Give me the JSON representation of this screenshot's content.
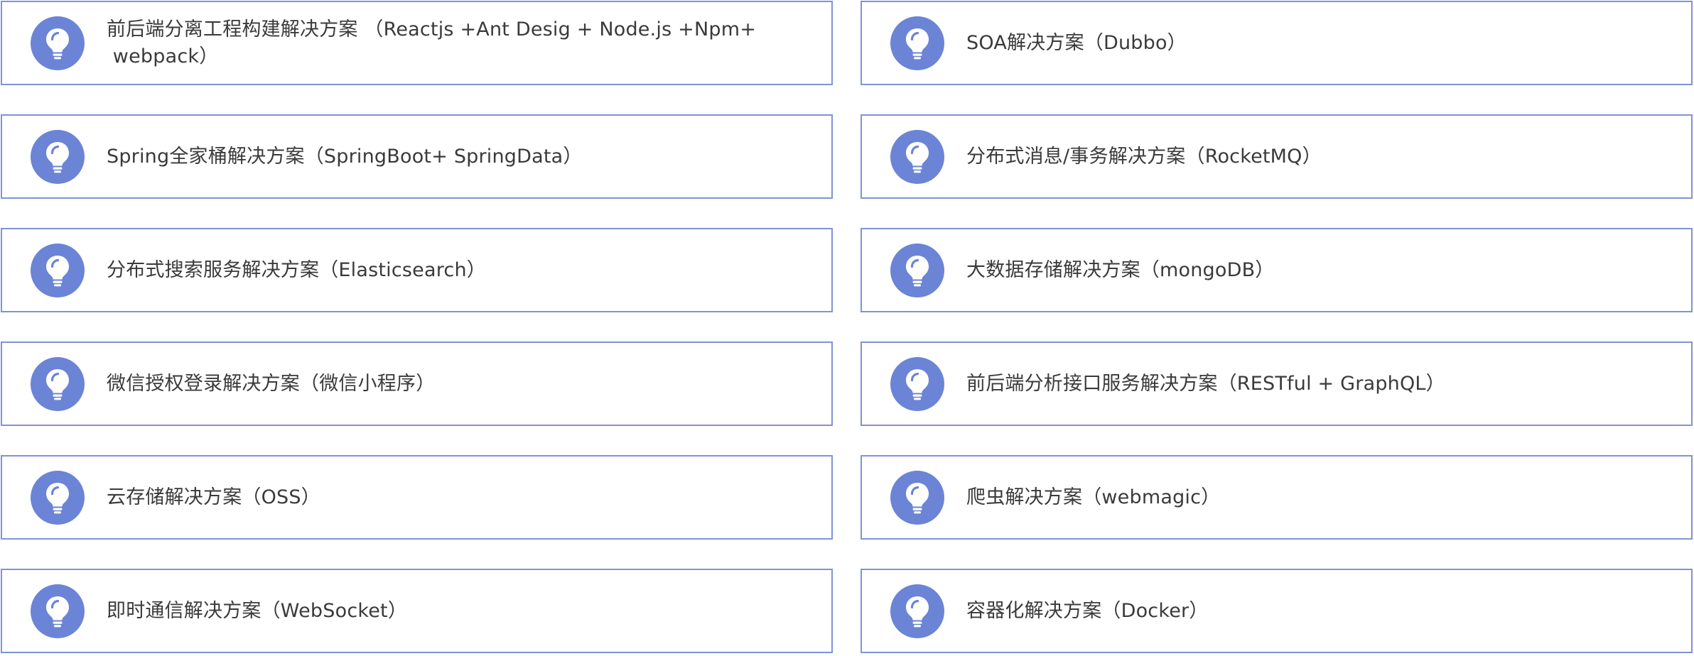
{
  "solutions": {
    "items": [
      {
        "label": "前后端分离工程构建解决方案 （Reactjs +Ant Desig + Node.js +Npm+\n webpack）",
        "icon": "lightbulb-icon"
      },
      {
        "label": "SOA解决方案（Dubbo）",
        "icon": "lightbulb-icon"
      },
      {
        "label": "Spring全家桶解决方案（SpringBoot+ SpringData）",
        "icon": "lightbulb-icon"
      },
      {
        "label": "分布式消息/事务解决方案（RocketMQ）",
        "icon": "lightbulb-icon"
      },
      {
        "label": "分布式搜索服务解决方案（Elasticsearch）",
        "icon": "lightbulb-icon"
      },
      {
        "label": "大数据存储解决方案（mongoDB）",
        "icon": "lightbulb-icon"
      },
      {
        "label": "微信授权登录解决方案（微信小程序）",
        "icon": "lightbulb-icon"
      },
      {
        "label": "前后端分析接口服务解决方案（RESTful + GraphQL）",
        "icon": "lightbulb-icon"
      },
      {
        "label": "云存储解决方案（OSS）",
        "icon": "lightbulb-icon"
      },
      {
        "label": "爬虫解决方案（webmagic）",
        "icon": "lightbulb-icon"
      },
      {
        "label": "即时通信解决方案（WebSocket）",
        "icon": "lightbulb-icon"
      },
      {
        "label": "容器化解决方案（Docker）",
        "icon": "lightbulb-icon"
      }
    ]
  },
  "colors": {
    "border": "#7f93d9",
    "icon_bg": "#6b84d6",
    "text": "#3a3a3a"
  }
}
